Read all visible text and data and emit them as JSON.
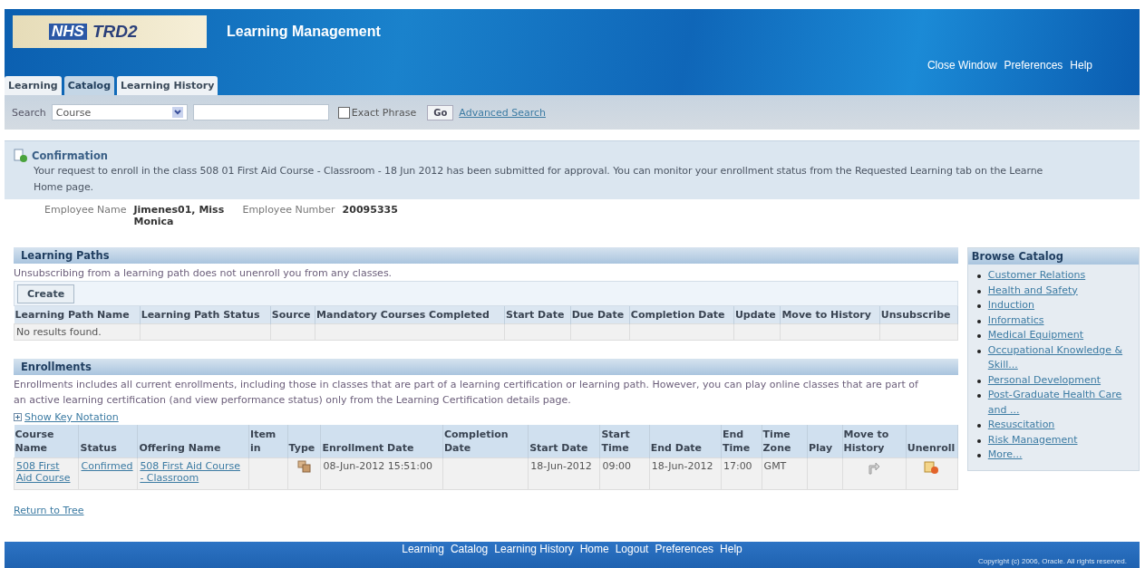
{
  "header": {
    "logo_badge": "NHS",
    "logo_text": "TRD2",
    "title": "Learning Management",
    "global_links": [
      "Close Window",
      "Preferences",
      "Help"
    ]
  },
  "tabs": [
    {
      "label": "Learning",
      "selected": false
    },
    {
      "label": "Catalog",
      "selected": true
    },
    {
      "label": "Learning History",
      "selected": false
    }
  ],
  "search": {
    "label": "Search",
    "dropdown": "Course",
    "exact_phrase": {
      "label": "Exact Phrase",
      "checked": false
    },
    "go": "Go",
    "advanced": "Advanced Search"
  },
  "confirmation": {
    "title": "Confirmation",
    "lines": [
      "Your request to enroll in the class 508 01 First Aid Course - Classroom - 18 Jun 2012 has been submitted for approval. You can monitor your enrollment status from the Requested Learning tab on the Learne",
      "Home page."
    ]
  },
  "employee": {
    "name_label": "Employee Name",
    "name": "Jimenes01, Miss Monica",
    "number_label": "Employee Number",
    "number": "20095335"
  },
  "learning_paths": {
    "title": "Learning Paths",
    "note": "Unsubscribing from a learning path does not unenroll you from any classes.",
    "create": "Create",
    "columns": [
      "Learning Path Name",
      "Learning Path Status",
      "Source",
      "Mandatory Courses Completed",
      "Start Date",
      "Due Date",
      "Completion Date",
      "Update",
      "Move to History",
      "Unsubscribe"
    ],
    "empty": "No results found."
  },
  "enrollments": {
    "title": "Enrollments",
    "description": "Enrollments includes all current enrollments, including those in classes that are part of a learning certification or learning path. However, you can play online classes that are part of an active learning certification (and view performance status) only from the Learning Certification details page.",
    "key_notation": "Show Key Notation",
    "columns": [
      "Course Name",
      "Status",
      "Offering Name",
      "Item in",
      "Type",
      "Enrollment Date",
      "Completion Date",
      "Start Date",
      "Start Time",
      "End Date",
      "End Time",
      "Time Zone",
      "Play",
      "Move to History",
      "Unenroll"
    ],
    "rows": [
      {
        "cells": [
          {
            "kind": "link",
            "text": "508 First Aid Course"
          },
          {
            "kind": "link",
            "text": "Confirmed"
          },
          {
            "kind": "link",
            "text": "508 First Aid Course - Classroom"
          },
          {
            "kind": "empty"
          },
          {
            "kind": "type-icon"
          },
          {
            "kind": "text",
            "text": "08-Jun-2012 15:51:00"
          },
          {
            "kind": "empty"
          },
          {
            "kind": "text",
            "text": "18-Jun-2012"
          },
          {
            "kind": "text",
            "text": "09:00"
          },
          {
            "kind": "text",
            "text": "18-Jun-2012"
          },
          {
            "kind": "text",
            "text": "17:00"
          },
          {
            "kind": "text",
            "text": "GMT"
          },
          {
            "kind": "empty"
          },
          {
            "kind": "history-icon"
          },
          {
            "kind": "unenroll-icon"
          }
        ]
      }
    ]
  },
  "return_link": "Return to Tree",
  "browse": {
    "title": "Browse Catalog",
    "items": [
      "Customer Relations",
      "Health and Safety",
      "Induction",
      "Informatics",
      "Medical Equipment",
      "Occupational Knowledge & Skill...",
      "Personal Development",
      "Post-Graduate Health Care and ...",
      "Resuscitation",
      "Risk Management",
      "More..."
    ]
  },
  "footer": {
    "links": [
      "Learning",
      "Catalog",
      "Learning History",
      "Home",
      "Logout",
      "Preferences",
      "Help"
    ],
    "copyright": "Copyright (c) 2006, Oracle. All rights reserved."
  }
}
